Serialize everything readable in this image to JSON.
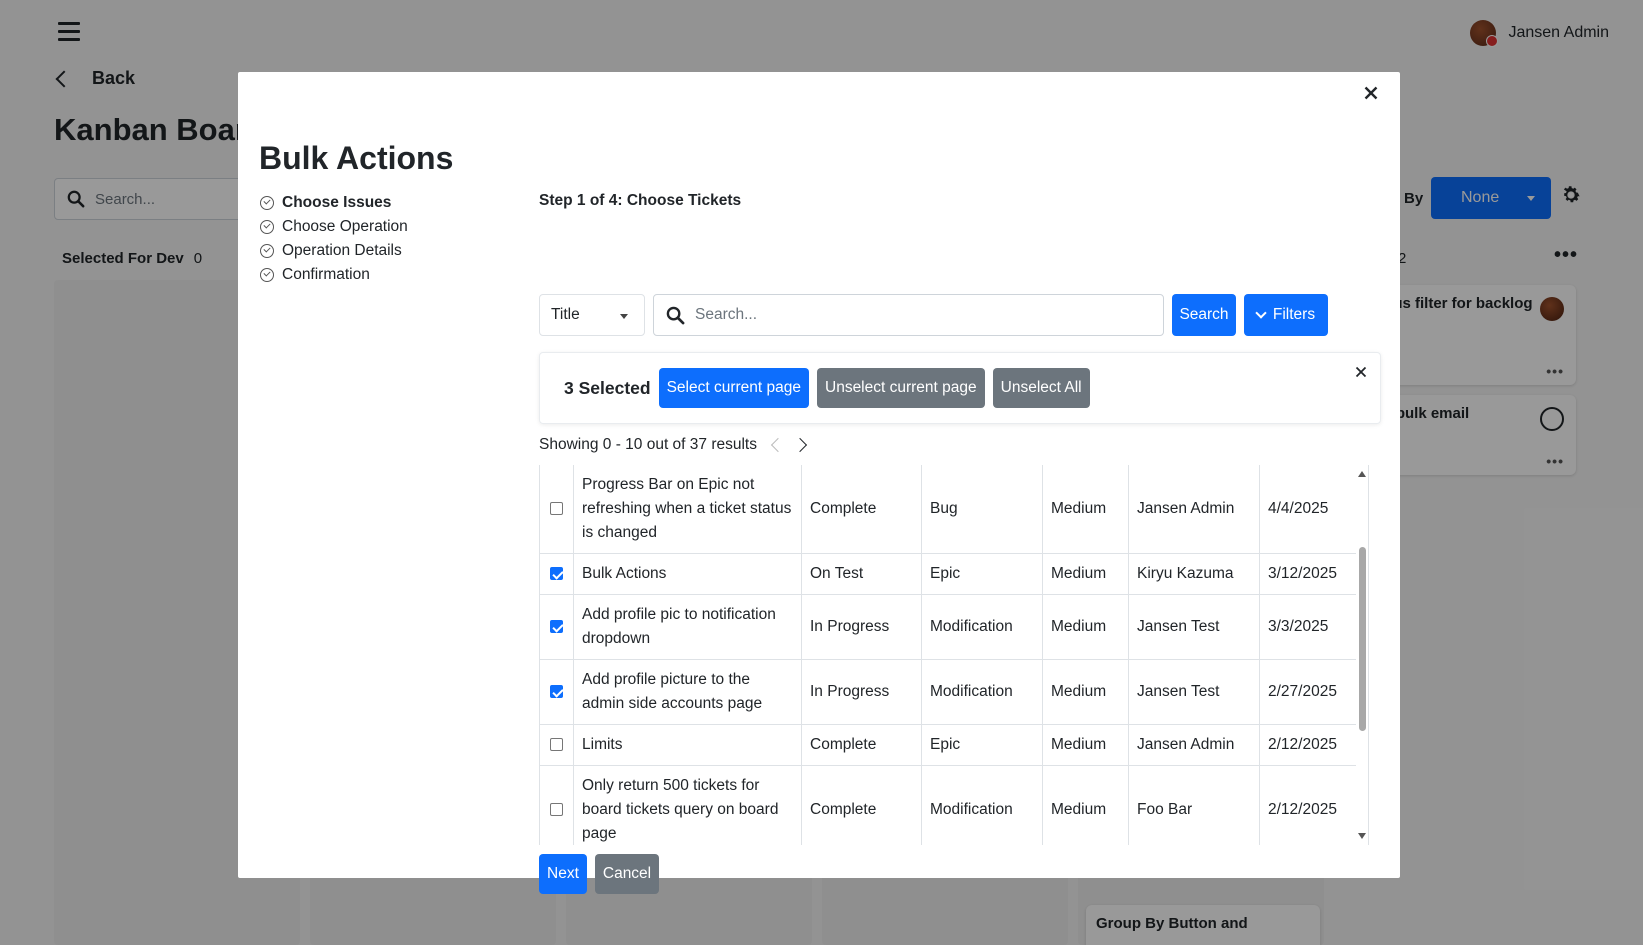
{
  "background": {
    "user_name": "Jansen Admin",
    "back_label": "Back",
    "board_title": "Kanban Board",
    "search_placeholder": "Search...",
    "column1": {
      "title": "Selected For Dev",
      "count": "0"
    },
    "group_by_label": "By",
    "group_by_value": "None",
    "column_count": "2",
    "cards": [
      {
        "text": "atus filter for backlog"
      },
      {
        "text": "Q bulk email"
      },
      {
        "text": "Group By Button and"
      }
    ]
  },
  "modal": {
    "title": "Bulk Actions",
    "steps": [
      {
        "label": "Choose Issues",
        "active": true
      },
      {
        "label": "Choose Operation",
        "active": false
      },
      {
        "label": "Operation Details",
        "active": false
      },
      {
        "label": "Confirmation",
        "active": false
      }
    ],
    "step_heading": "Step 1 of 4: Choose Tickets",
    "field_select": "Title",
    "search_placeholder": "Search...",
    "search_button": "Search",
    "filters_button": "Filters",
    "selection": {
      "count_label": "3 Selected",
      "select_page": "Select current page",
      "unselect_page": "Unselect current page",
      "unselect_all": "Unselect All"
    },
    "showing": "Showing 0 - 10 out of 37 results",
    "rows": [
      {
        "checked": false,
        "title": "Progress Bar on Epic not refreshing when a ticket status is changed",
        "status": "Complete",
        "type": "Bug",
        "priority": "Medium",
        "assignee": "Jansen Admin",
        "date": "4/4/2025"
      },
      {
        "checked": true,
        "title": "Bulk Actions",
        "status": "On Test",
        "type": "Epic",
        "priority": "Medium",
        "assignee": "Kiryu Kazuma",
        "date": "3/12/2025"
      },
      {
        "checked": true,
        "title": "Add profile pic to notification dropdown",
        "status": "In Progress",
        "type": "Modification",
        "priority": "Medium",
        "assignee": "Jansen Test",
        "date": "3/3/2025"
      },
      {
        "checked": true,
        "title": "Add profile picture to the admin side accounts page",
        "status": "In Progress",
        "type": "Modification",
        "priority": "Medium",
        "assignee": "Jansen Test",
        "date": "2/27/2025"
      },
      {
        "checked": false,
        "title": "Limits",
        "status": "Complete",
        "type": "Epic",
        "priority": "Medium",
        "assignee": "Jansen Admin",
        "date": "2/12/2025"
      },
      {
        "checked": false,
        "title": "Only return 500 tickets for board tickets query on board page",
        "status": "Complete",
        "type": "Modification",
        "priority": "Medium",
        "assignee": "Foo Bar",
        "date": "2/12/2025"
      }
    ],
    "next_button": "Next",
    "cancel_button": "Cancel"
  },
  "colors": {
    "primary": "#0d6efd",
    "secondary": "#6c757d"
  }
}
